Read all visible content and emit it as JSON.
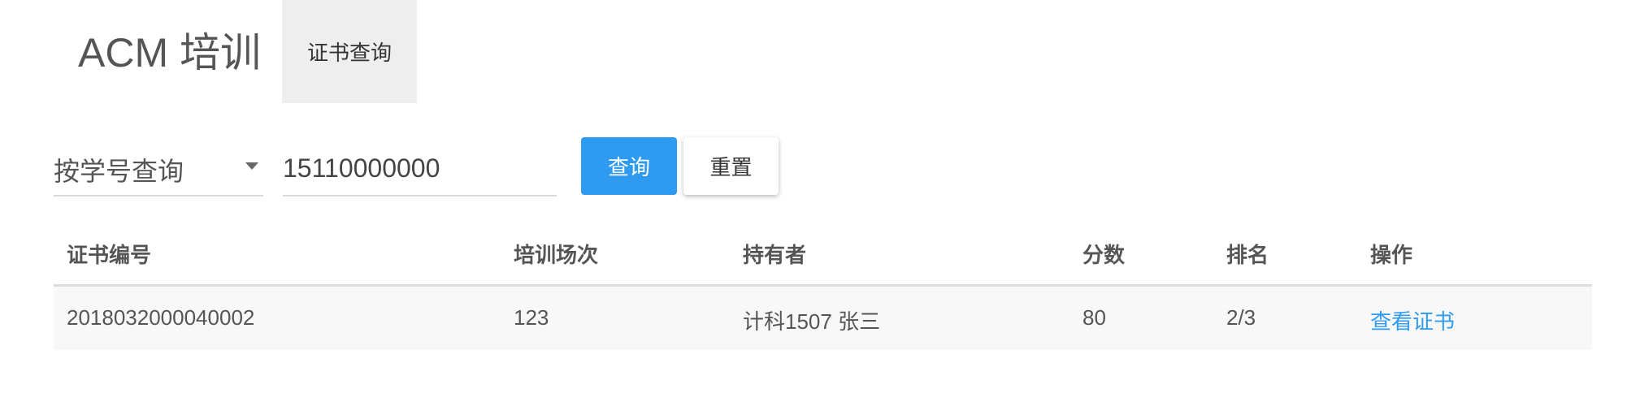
{
  "header": {
    "brand": "ACM 培训",
    "nav_tab": "证书查询"
  },
  "search": {
    "mode_selected": "按学号查询",
    "query_value": "15110000000",
    "submit_label": "查询",
    "reset_label": "重置"
  },
  "table": {
    "columns": [
      "证书编号",
      "培训场次",
      "持有者",
      "分数",
      "排名",
      "操作"
    ],
    "rows": [
      {
        "cert_no": "2018032000040002",
        "session": "123",
        "holder": "计科1507 张三",
        "score": "80",
        "rank": "2/3",
        "action": "查看证书"
      }
    ]
  },
  "colors": {
    "accent": "#2f9bf0",
    "tab_bg": "#eeeeee",
    "row_bg": "#f8f8f8"
  }
}
